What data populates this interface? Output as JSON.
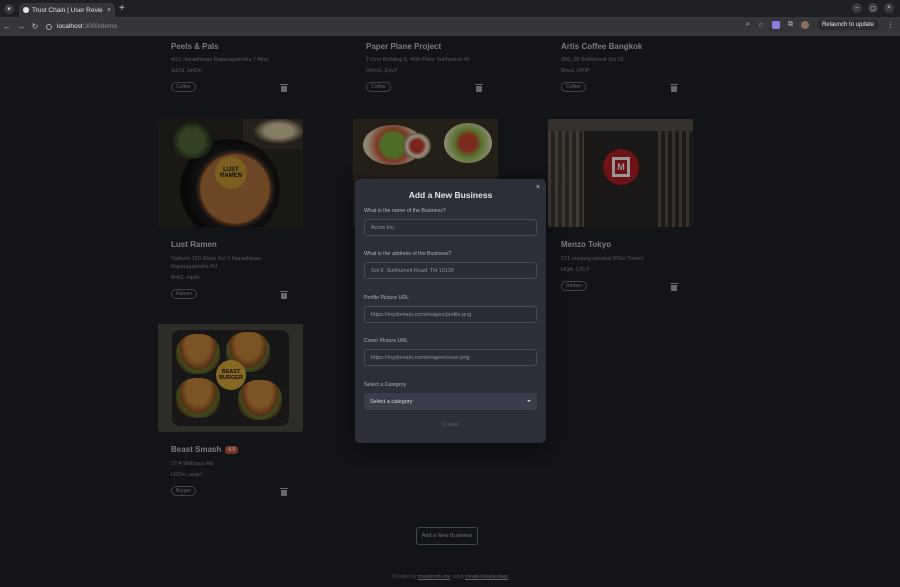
{
  "browser": {
    "tab_title": "Trust Chain | User Revie",
    "new_tab": "+",
    "url_host": "localhost",
    "url_path": ":3000/demo",
    "relaunch_label": "Relaunch to update"
  },
  "cards": [
    {
      "title": "Peels & Pals",
      "address": "43/1 Naradhiwas Rajanagarindra 7 Alley",
      "hash": "3uOd..bnDm",
      "category": "Coffee",
      "image": ""
    },
    {
      "title": "Paper Plane Project",
      "address": "T-One Building 6, 40th Floor Sukhumvit 40",
      "hash": "5RmG..EyvY",
      "category": "Coffee",
      "image": ""
    },
    {
      "title": "Artis Coffee Bangkok",
      "address": "390, 26 Sukhumvit Soi 16",
      "hash": "8bw1..HYiP",
      "category": "Coffee",
      "image": ""
    },
    {
      "title": "Lust Ramen",
      "address": "Sathorn 150 Silom Soi 3 Naradhiwas Rajanagarindra Rd",
      "hash": "8HrC..Hpdc",
      "category": "Ramen",
      "image": "ramen"
    },
    {
      "title": "",
      "address": "",
      "hash": "",
      "category": "",
      "image": "salad"
    },
    {
      "title": "Menzo Tokyo",
      "address": "571 ensiong mooted (RSU Tower)",
      "hash": "HQA..UTLY",
      "category": "Ramen",
      "image": "menzo"
    },
    {
      "title": "Beast Smash",
      "tag": "4.0",
      "address": "27/4 Witthayu Rd",
      "hash": "H2Zm..arqs7",
      "category": "Burger",
      "image": "burger"
    }
  ],
  "image_logos": {
    "ramen": "LUST RAMEN",
    "burger": "BEAST BURGER",
    "menzo": "M"
  },
  "modal": {
    "title": "Add a New Business",
    "close": "×",
    "fields": [
      {
        "label": "What is the name of the Business?",
        "placeholder": "Acme Inc."
      },
      {
        "label": "What is the address of the Business?",
        "placeholder": "Soi 6. Sukhumvit Road. TH 10120"
      },
      {
        "label": "Profile Picture URL",
        "placeholder": "https://mydomain.com/images/profile.png"
      },
      {
        "label": "Cover Picture URL",
        "placeholder": "https://mydomain.com/images/cover.png"
      }
    ],
    "category_label": "Select a Category",
    "category_value": "Select a category",
    "submit_label": "Create"
  },
  "add_button_label": "Add a New Business",
  "footer": {
    "prefix": "Created by",
    "author": "maxsiondu.me",
    "middle": "using",
    "link": "create-solana-dapp"
  }
}
